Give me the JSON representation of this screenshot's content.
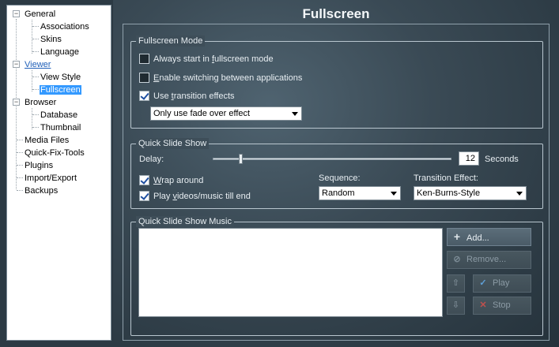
{
  "tree": {
    "items": [
      {
        "label": "General",
        "expander": "−"
      },
      {
        "label": "Associations"
      },
      {
        "label": "Skins"
      },
      {
        "label": "Language"
      },
      {
        "label": "Viewer",
        "expander": "−"
      },
      {
        "label": "View Style"
      },
      {
        "label": "Fullscreen"
      },
      {
        "label": "Browser",
        "expander": "−"
      },
      {
        "label": "Database"
      },
      {
        "label": "Thumbnail"
      },
      {
        "label": "Media Files"
      },
      {
        "label": "Quick-Fix-Tools"
      },
      {
        "label": "Plugins"
      },
      {
        "label": "Import/Export"
      },
      {
        "label": "Backups"
      }
    ]
  },
  "page": {
    "title": "Fullscreen"
  },
  "fullscreen_mode": {
    "group_title": "Fullscreen Mode",
    "always_start": {
      "pre": "Always start in ",
      "u": "f",
      "post": "ullscreen mode",
      "checked": false
    },
    "enable_switching": {
      "pre": "",
      "u": "E",
      "post": "nable switching between applications",
      "checked": false
    },
    "use_transition": {
      "pre": "Use ",
      "u": "t",
      "post": "ransition effects",
      "checked": true
    },
    "effect_select": "Only use fade over effect"
  },
  "quick_slide_show": {
    "group_title": "Quick Slide Show",
    "delay_label": "Delay:",
    "delay_value": "12",
    "delay_unit": "Seconds",
    "delay_fraction": 0.11,
    "wrap_around": {
      "pre": "",
      "u": "W",
      "post": "rap around",
      "checked": true
    },
    "play_videos": {
      "pre": "Play ",
      "u": "v",
      "post": "ideos/music till end",
      "checked": true
    },
    "sequence_label": "Sequence:",
    "sequence_value": "Random",
    "transition_label": "Transition Effect:",
    "transition_value": "Ken-Burns-Style"
  },
  "music": {
    "group_title": "Quick Slide Show Music",
    "add_label": "Add...",
    "remove_label": "Remove...",
    "play_label": "Play",
    "stop_label": "Stop"
  },
  "colors": {
    "accent": "#3399ff",
    "background": "#2c3a44"
  }
}
